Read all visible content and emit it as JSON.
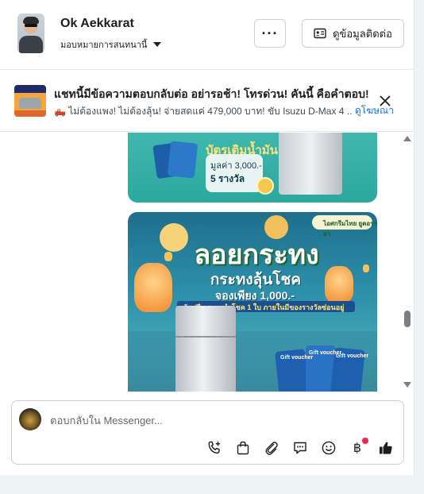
{
  "header": {
    "user_name": "Ok Aekkarat",
    "assign_label": "มอบหมายการสนทนานี้",
    "more_label": "···",
    "contact_button_label": "ดูข้อมูลติดต่อ"
  },
  "ad": {
    "title": "แชทนี้มีข้อความตอบกลับต่อ อย่ารอช้า! โทรด่วน! คันนี้ คือคำตอบ!",
    "subtitle": "🛻 ไม่ต้องแพง! ไม่ต้องลุ้น! จ่ายสดแค่ 479,000 บาท! ขับ Isuzu D-Max 4 ...",
    "link_label": "ดูโฆษณา"
  },
  "messages": {
    "image1": {
      "headline": "บัตรเติมน้ำมัน",
      "value_line": "มูลค่า 3,000.-",
      "count_line": "5 รางวัล"
    },
    "image2": {
      "brand": "ไอศกรีมไทย ยูดอรายา",
      "title": "ลอยกระทง",
      "subtitle": "กระทงลุ้นโชค",
      "price_line": "จองเพียง 1,000.-",
      "banner": "รับฟรี กระทงนำโชค 1 ใบ ภายในมีของรางวัลซ่อนอยู่",
      "voucher_label": "Gift voucher"
    }
  },
  "composer": {
    "placeholder": "ตอบกลับใน Messenger...",
    "baht_symbol": "฿"
  },
  "icons": [
    "phone-add-icon",
    "bag-icon",
    "paperclip-icon",
    "chat-bubble-icon",
    "smiley-icon",
    "baht-icon",
    "thumbs-up-icon"
  ],
  "colors": {
    "link": "#1b74e4",
    "notification_dot": "#f02849",
    "border": "#ccd0d5"
  }
}
